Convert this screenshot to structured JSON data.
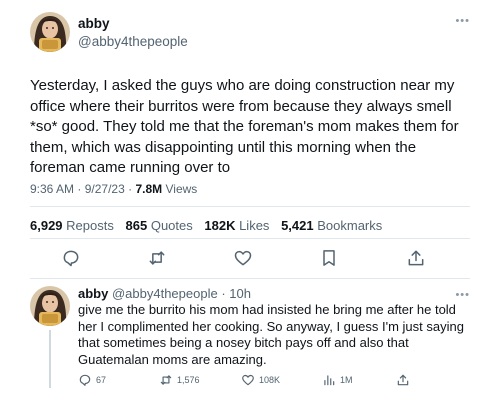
{
  "main_tweet": {
    "author_name": "abby",
    "author_handle": "@abby4thepeople",
    "text": "Yesterday, I asked the guys who are doing construction near my office where their burritos were from because they always smell *so* good. They told me that the foreman's mom makes them for them, which was disappointing until this morning when the foreman came running over to",
    "time": "9:36 AM",
    "date": "9/27/23",
    "views_count": "7.8M",
    "views_label": "Views",
    "reposts_count": "6,929",
    "reposts_label": "Reposts",
    "quotes_count": "865",
    "quotes_label": "Quotes",
    "likes_count": "182K",
    "likes_label": "Likes",
    "bookmarks_count": "5,421",
    "bookmarks_label": "Bookmarks"
  },
  "reply": {
    "author_name": "abby",
    "author_handle": "@abby4thepeople",
    "age": "10h",
    "text": "give me the burrito his mom had insisted he bring me after he told her I complimented her cooking. So anyway, I guess I'm just saying that sometimes being a nosey bitch pays off and also that Guatemalan moms are amazing.",
    "replies_count": "67",
    "reposts_count": "1,576",
    "likes_count": "108K",
    "views_count": "1M"
  },
  "icons": {
    "reply": "reply-icon",
    "repost": "repost-icon",
    "like": "heart-icon",
    "bookmark": "bookmark-icon",
    "share": "share-icon",
    "views": "views-icon",
    "more": "more-icon"
  },
  "colors": {
    "text": "#0f1419",
    "secondary": "#536471",
    "icon": "#536471",
    "divider": "#e1e8ed",
    "thread_line": "#cfd9de"
  }
}
